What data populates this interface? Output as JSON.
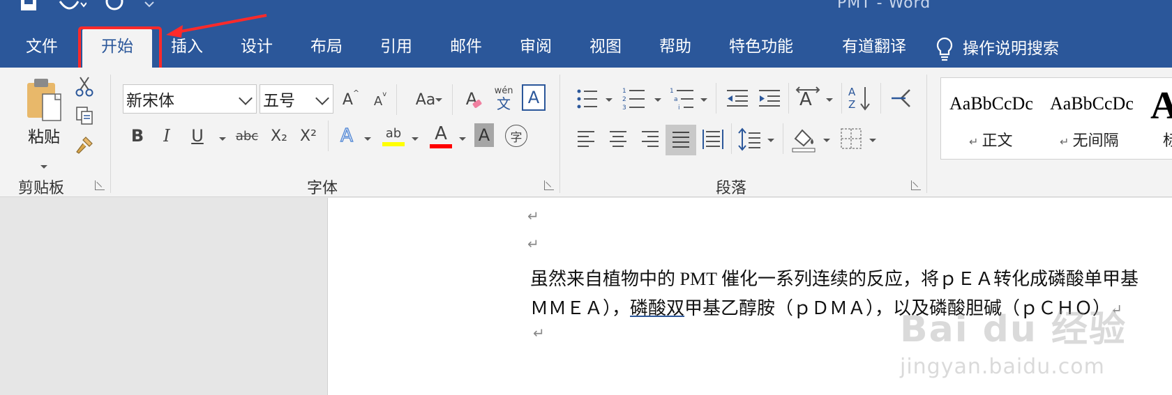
{
  "window": {
    "title": "PMT  -  Word"
  },
  "tabs": [
    "文件",
    "开始",
    "插入",
    "设计",
    "布局",
    "引用",
    "邮件",
    "审阅",
    "视图",
    "帮助",
    "特色功能",
    "有道翻译"
  ],
  "active_tab": "开始",
  "search": {
    "label": "操作说明搜索"
  },
  "clipboard": {
    "paste_label": "粘贴",
    "group_label": "剪贴板"
  },
  "font": {
    "name": "新宋体",
    "size": "五号",
    "group_label": "字体",
    "bold": "B",
    "italic": "I",
    "underline": "U",
    "strike": "abc",
    "subscript": "X₂",
    "superscript": "X²",
    "change_case": "Aa",
    "phonetic": "wén",
    "phonetic_char": "文",
    "grow": "A",
    "shrink": "A",
    "clear": "A",
    "border_char": "A",
    "effects": "A",
    "highlight": "ab",
    "color": "A",
    "shading": "A",
    "enclose": "字"
  },
  "paragraph": {
    "group_label": "段落"
  },
  "styles": [
    {
      "sample": "AaBbCcDc",
      "name": "正文"
    },
    {
      "sample": "AaBbCcDc",
      "name": "无间隔"
    },
    {
      "sample": "A",
      "name": "标"
    }
  ],
  "document": {
    "line1": "虽然来自植物中的 PMT 催化一系列连续的反应，将ｐＥＡ转化成磷酸单甲基",
    "line2_pre": "ＭＭＥＡ），",
    "line2_underlined": "磷酸双",
    "line2_post": "甲基乙醇胺（ｐＤＭＡ），以及磷酸胆碱（ｐＣＨＯ）",
    "para_mark": "↵"
  },
  "watermark": {
    "brand": "Bai du 经验",
    "url": "jingyan.baidu.com"
  },
  "colors": {
    "accent": "#2b579a",
    "highlight_box": "#ff2a2a",
    "highlight_yellow": "#ffff00",
    "font_red": "#ff0000"
  }
}
